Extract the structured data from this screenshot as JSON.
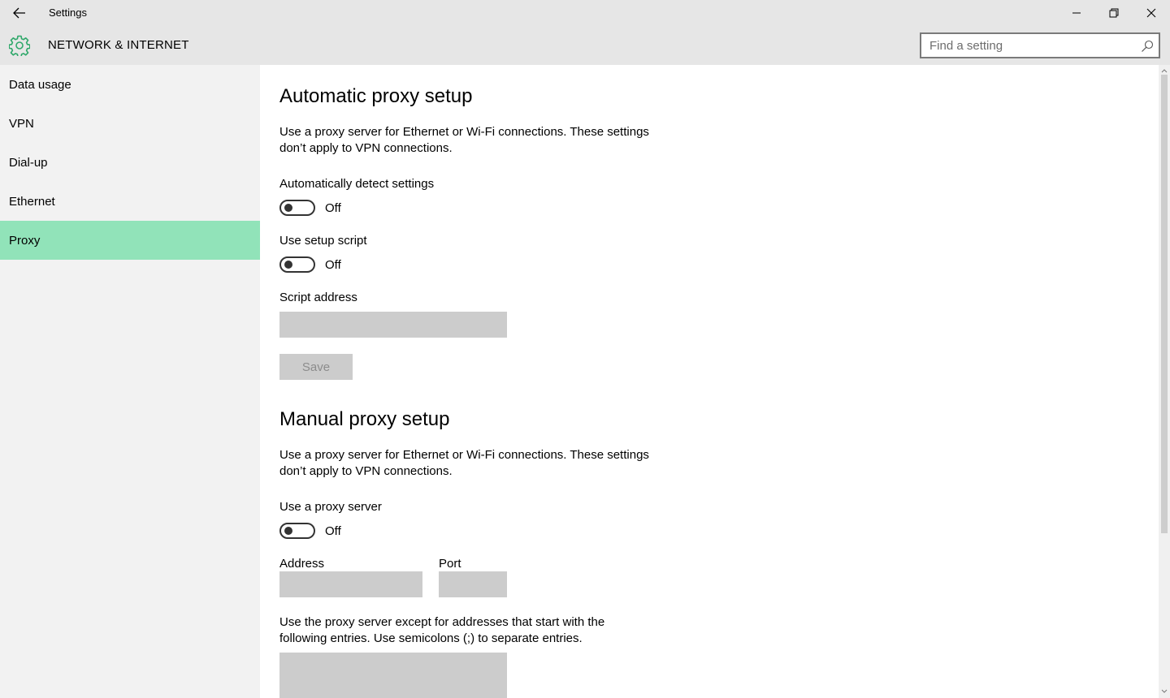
{
  "window": {
    "title": "Settings",
    "back_icon": "arrow-left-icon",
    "controls": [
      "minimize-icon",
      "restore-icon",
      "close-icon"
    ]
  },
  "header": {
    "icon": "gear-icon",
    "section_title": "NETWORK & INTERNET",
    "search": {
      "placeholder": "Find a setting",
      "value": ""
    }
  },
  "sidebar": {
    "items": [
      {
        "label": "Data usage",
        "selected": false
      },
      {
        "label": "VPN",
        "selected": false
      },
      {
        "label": "Dial-up",
        "selected": false
      },
      {
        "label": "Ethernet",
        "selected": false
      },
      {
        "label": "Proxy",
        "selected": true
      }
    ]
  },
  "automatic": {
    "heading": "Automatic proxy setup",
    "description_line1": "Use a proxy server for Ethernet or Wi-Fi connections. These settings",
    "description_line2": "don’t apply to VPN connections.",
    "detect_label": "Automatically detect settings",
    "detect_state": "Off",
    "script_label": "Use setup script",
    "script_state": "Off",
    "script_address_label": "Script address",
    "script_address_value": "",
    "save_label": "Save"
  },
  "manual": {
    "heading": "Manual proxy setup",
    "description_line1": "Use a proxy server for Ethernet or Wi-Fi connections. These settings",
    "description_line2": "don’t apply to VPN connections.",
    "use_proxy_label": "Use a proxy server",
    "use_proxy_state": "Off",
    "address_label": "Address",
    "address_value": "",
    "port_label": "Port",
    "port_value": "",
    "exceptions_line1": "Use the proxy server except for addresses that start with the",
    "exceptions_line2": "following entries. Use semicolons (;) to separate entries.",
    "exceptions_value": ""
  },
  "colors": {
    "accent": "#91e3b9",
    "gear": "#2fa86a",
    "chrome": "#e6e6e6",
    "sidebar": "#f2f2f2",
    "field": "#cccccc"
  }
}
